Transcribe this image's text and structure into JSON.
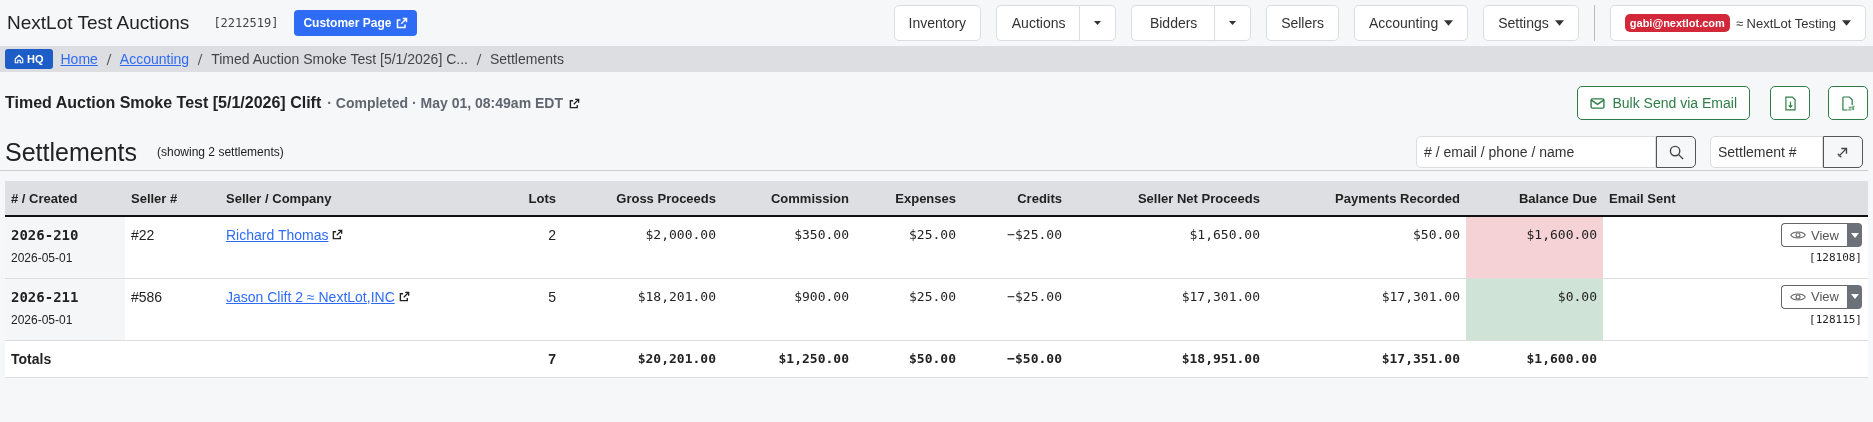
{
  "header": {
    "title": "NextLot Test Auctions",
    "account_id": "[2212519]",
    "customer_button": "Customer Page",
    "nav": [
      {
        "kind": "plain",
        "label": "Inventory"
      },
      {
        "kind": "split",
        "label": "Auctions"
      },
      {
        "kind": "split",
        "label": "Bidders"
      },
      {
        "kind": "plain",
        "label": "Sellers"
      },
      {
        "kind": "dropdown",
        "label": "Accounting"
      },
      {
        "kind": "dropdown",
        "label": "Settings"
      }
    ],
    "user": {
      "email": "gabi@nextlot.com",
      "org": "≈ NextLot Testing"
    }
  },
  "breadcrumb": {
    "badge": "HQ",
    "items": [
      {
        "label": "Home",
        "kind": "link"
      },
      {
        "label": "Accounting",
        "kind": "link"
      },
      {
        "label": "Timed Auction Smoke Test [5/1/2026] C...",
        "kind": "text"
      },
      {
        "label": "Settlements",
        "kind": "text"
      }
    ]
  },
  "auction": {
    "title": "Timed Auction Smoke Test [5/1/2026] Clift",
    "status": "· Completed · May 01, 08:49am EDT",
    "bulk_button": "Bulk Send via Email"
  },
  "settlements": {
    "heading": "Settlements",
    "count_note": "(showing 2 settlements)",
    "search_placeholder": "# / email / phone / name",
    "number_placeholder": "Settlement #"
  },
  "table": {
    "columns": [
      "# / Created",
      "Seller #",
      "Seller / Company",
      "Lots",
      "Gross Proceeds",
      "Commission",
      "Expenses",
      "Credits",
      "Seller Net Proceeds",
      "Payments Recorded",
      "Balance Due",
      "Email Sent"
    ],
    "rows": [
      {
        "number": "2026-210",
        "created": "2026-05-01",
        "seller_no": "#22",
        "seller": "Richard Thomas",
        "lots": "2",
        "gross": "$2,000.00",
        "commission": "$350.00",
        "expenses": "$25.00",
        "credits": "−$25.00",
        "net": "$1,650.00",
        "payments": "$50.00",
        "balance": "$1,600.00",
        "paid": false,
        "view": "View",
        "ref": "[128108]"
      },
      {
        "number": "2026-211",
        "created": "2026-05-01",
        "seller_no": "#586",
        "seller": "Jason Clift 2 ≈ NextLot,INC",
        "lots": "5",
        "gross": "$18,201.00",
        "commission": "$900.00",
        "expenses": "$25.00",
        "credits": "−$25.00",
        "net": "$17,301.00",
        "payments": "$17,301.00",
        "balance": "$0.00",
        "paid": true,
        "view": "View",
        "ref": "[128115]"
      }
    ],
    "totals": {
      "label": "Totals",
      "lots": "7",
      "gross": "$20,201.00",
      "commission": "$1,250.00",
      "expenses": "$50.00",
      "credits": "−$50.00",
      "net": "$18,951.00",
      "payments": "$17,351.00",
      "balance": "$1,600.00"
    }
  }
}
